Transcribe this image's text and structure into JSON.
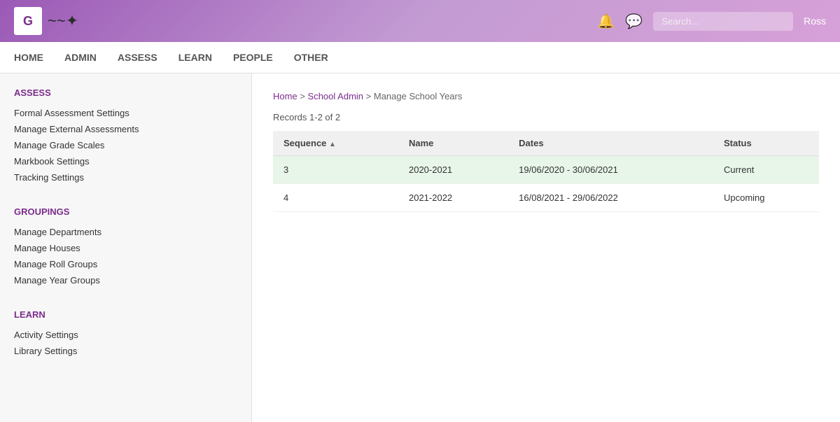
{
  "header": {
    "logo_letter": "G",
    "username": "Ross",
    "search_placeholder": "Search..."
  },
  "nav": {
    "items": [
      {
        "label": "HOME",
        "id": "home"
      },
      {
        "label": "ADMIN",
        "id": "admin"
      },
      {
        "label": "ASSESS",
        "id": "assess"
      },
      {
        "label": "LEARN",
        "id": "learn"
      },
      {
        "label": "PEOPLE",
        "id": "people"
      },
      {
        "label": "OTHER",
        "id": "other"
      }
    ]
  },
  "sidebar": {
    "sections": [
      {
        "title": "ASSESS",
        "id": "assess",
        "links": [
          {
            "label": "Formal Assessment Settings",
            "id": "formal-assessment"
          },
          {
            "label": "Manage External Assessments",
            "id": "manage-external"
          },
          {
            "label": "Manage Grade Scales",
            "id": "manage-grade"
          },
          {
            "label": "Markbook Settings",
            "id": "markbook"
          },
          {
            "label": "Tracking Settings",
            "id": "tracking"
          }
        ]
      },
      {
        "title": "GROUPINGS",
        "id": "groupings",
        "links": [
          {
            "label": "Manage Departments",
            "id": "manage-departments"
          },
          {
            "label": "Manage Houses",
            "id": "manage-houses"
          },
          {
            "label": "Manage Roll Groups",
            "id": "manage-roll-groups"
          },
          {
            "label": "Manage Year Groups",
            "id": "manage-year-groups"
          }
        ]
      },
      {
        "title": "LEARN",
        "id": "learn",
        "links": [
          {
            "label": "Activity Settings",
            "id": "activity-settings"
          },
          {
            "label": "Library Settings",
            "id": "library-settings"
          }
        ]
      }
    ]
  },
  "breadcrumb": {
    "items": [
      {
        "label": "Home",
        "href": "#"
      },
      {
        "label": "School Admin",
        "href": "#"
      },
      {
        "label": "Manage School Years",
        "href": "#"
      }
    ]
  },
  "records_info": "Records 1-2 of 2",
  "table": {
    "columns": [
      {
        "label": "Sequence",
        "sortable": true,
        "sort_icon": "▲"
      },
      {
        "label": "Name",
        "sortable": false
      },
      {
        "label": "Dates",
        "sortable": false
      },
      {
        "label": "Status",
        "sortable": false
      }
    ],
    "rows": [
      {
        "sequence": "3",
        "name": "2020-2021",
        "dates": "19/06/2020 - 30/06/2021",
        "status": "Current",
        "row_class": "current-row"
      },
      {
        "sequence": "4",
        "name": "2021-2022",
        "dates": "16/08/2021 - 29/06/2022",
        "status": "Upcoming",
        "row_class": "upcoming-row"
      }
    ]
  },
  "colors": {
    "purple": "#7b2d8b",
    "header_gradient_start": "#9b59b6",
    "header_gradient_end": "#d7a0d8"
  }
}
